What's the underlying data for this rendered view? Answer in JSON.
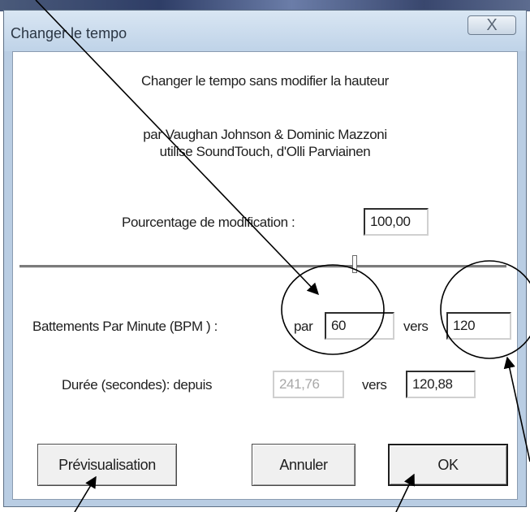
{
  "dialog": {
    "title": "Changer le tempo",
    "close_glyph": "X",
    "heading": "Changer le tempo sans modifier la hauteur",
    "credits_line1": "par Vaughan Johnson & Dominic Mazzoni",
    "credits_line2": "utilise SoundTouch, d'Olli Parviainen"
  },
  "percent": {
    "label": "Pourcentage de modification :",
    "value": "100,00"
  },
  "slider": {
    "level": 0.69
  },
  "bpm": {
    "label": "Battements Par Minute (BPM ) :",
    "from_label": "par",
    "from_value": "60",
    "to_label": "vers",
    "to_value": "120"
  },
  "duration": {
    "label": "Durée (secondes): depuis",
    "from_value": "241,76",
    "to_label": "vers",
    "to_value": "120,88"
  },
  "buttons": {
    "preview": "Prévisualisation",
    "cancel": "Annuler",
    "ok": "OK"
  },
  "colors": {
    "frame": "#b9cde3",
    "annotation": "#000000"
  }
}
